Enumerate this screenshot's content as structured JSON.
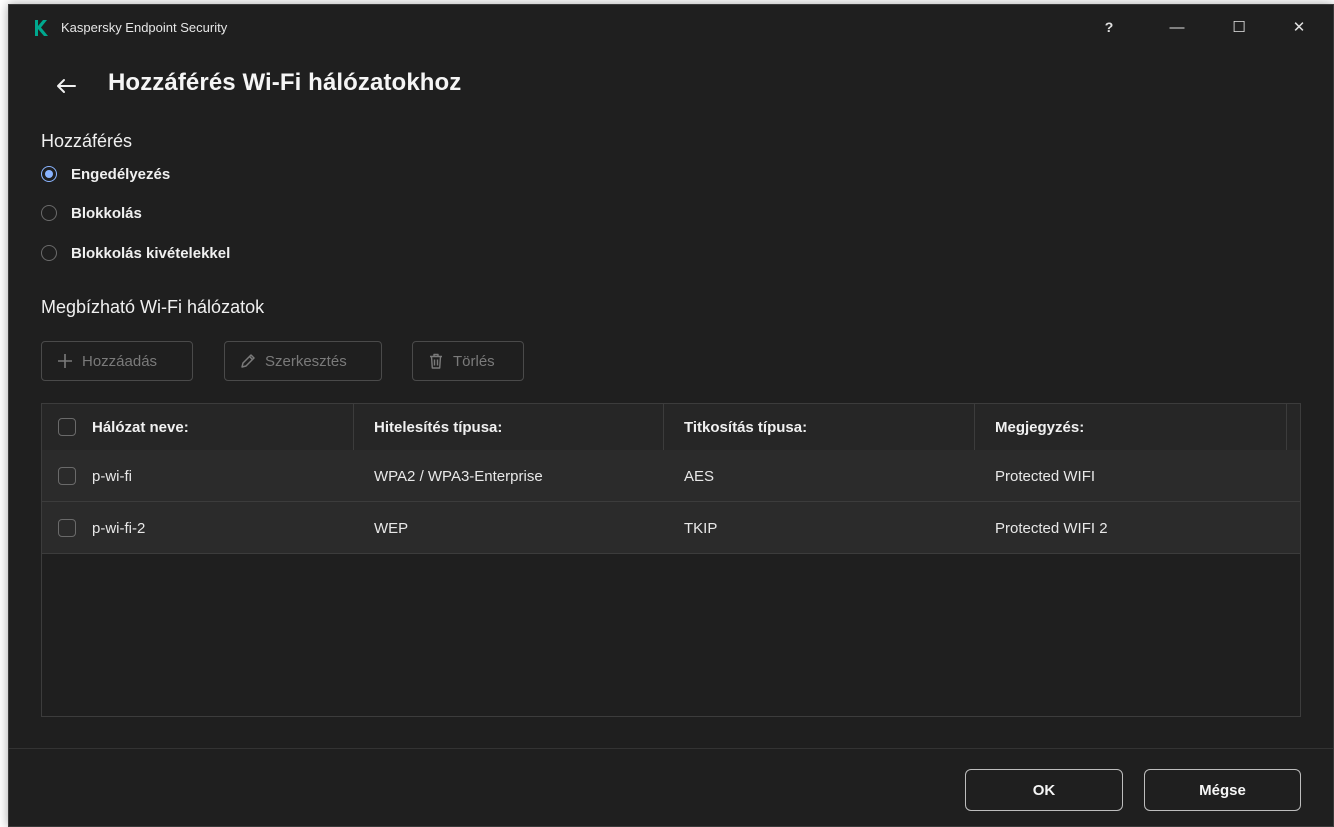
{
  "window": {
    "app_title": "Kaspersky Endpoint Security",
    "help_label": "?",
    "minimize_label": "—",
    "maximize_label": "☐",
    "close_label": "✕"
  },
  "header": {
    "title": "Hozzáférés Wi-Fi hálózatokhoz"
  },
  "access": {
    "title": "Hozzáférés",
    "options": [
      {
        "label": "Engedélyezés",
        "selected": true
      },
      {
        "label": "Blokkolás",
        "selected": false
      },
      {
        "label": "Blokkolás kivételekkel",
        "selected": false
      }
    ]
  },
  "trusted": {
    "title": "Megbízható Wi-Fi hálózatok",
    "toolbar": {
      "add_label": "Hozzáadás",
      "edit_label": "Szerkesztés",
      "delete_label": "Törlés",
      "enabled": false
    },
    "table": {
      "columns": [
        "Hálózat neve:",
        "Hitelesítés típusa:",
        "Titkosítás típusa:",
        "Megjegyzés:"
      ],
      "rows": [
        {
          "name": "p-wi-fi",
          "auth": "WPA2 / WPA3-Enterprise",
          "encryption": "AES",
          "comment": "Protected WIFI",
          "checked": false
        },
        {
          "name": "p-wi-fi-2",
          "auth": "WEP",
          "encryption": "TKIP",
          "comment": "Protected WIFI 2",
          "checked": false
        }
      ]
    }
  },
  "footer": {
    "ok_label": "OK",
    "cancel_label": "Mégse"
  },
  "colors": {
    "background": "#1f1f1f",
    "brand": "#00a88e",
    "radio_selected": "#8ab4ff",
    "disabled_text": "#7a7a7a"
  }
}
